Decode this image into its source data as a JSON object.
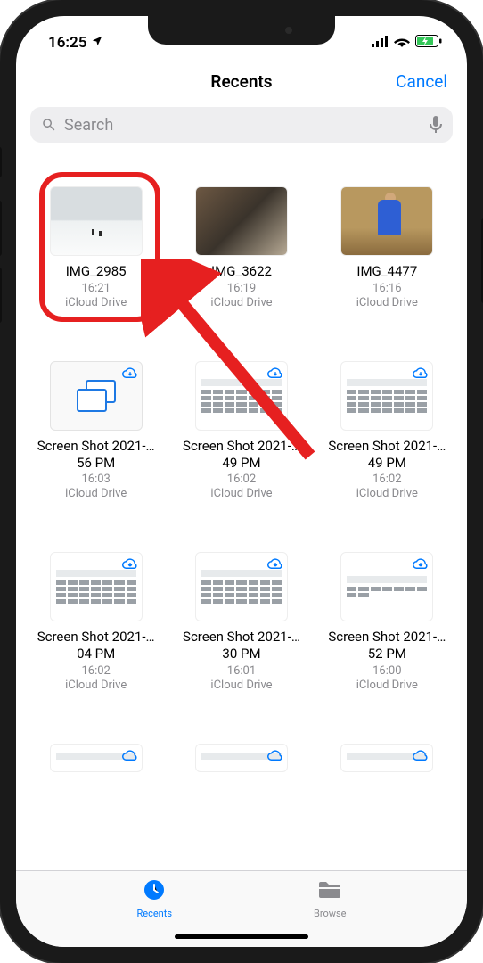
{
  "status": {
    "time": "16:25",
    "location_arrow": "➤"
  },
  "nav": {
    "title": "Recents",
    "cancel": "Cancel"
  },
  "search": {
    "placeholder": "Search"
  },
  "files": [
    {
      "name": "IMG_2985",
      "time": "16:21",
      "location": "iCloud Drive",
      "thumb": "snow",
      "cloud": false
    },
    {
      "name": "IMG_3622",
      "time": "16:19",
      "location": "iCloud Drive",
      "thumb": "dog",
      "cloud": false
    },
    {
      "name": "IMG_4477",
      "time": "16:16",
      "location": "iCloud Drive",
      "thumb": "person",
      "cloud": false
    },
    {
      "name": "Screen Shot 2021-…56 PM",
      "time": "16:03",
      "location": "iCloud Drive",
      "thumb": "doc",
      "cloud": true
    },
    {
      "name": "Screen Shot 2021-…49 PM",
      "time": "16:02",
      "location": "iCloud Drive",
      "thumb": "screenshot",
      "cloud": true
    },
    {
      "name": "Screen Shot 2021-…49 PM",
      "time": "16:02",
      "location": "iCloud Drive",
      "thumb": "screenshot",
      "cloud": true
    },
    {
      "name": "Screen Shot 2021-…04 PM",
      "time": "16:02",
      "location": "iCloud Drive",
      "thumb": "screenshot",
      "cloud": true
    },
    {
      "name": "Screen Shot 2021-…30 PM",
      "time": "16:01",
      "location": "iCloud Drive",
      "thumb": "screenshot",
      "cloud": true
    },
    {
      "name": "Screen Shot 2021-…52 PM",
      "time": "16:00",
      "location": "iCloud Drive",
      "thumb": "screenshot-sparse",
      "cloud": true
    }
  ],
  "tabs": {
    "recents": "Recents",
    "browse": "Browse"
  },
  "highlighted_index": 0
}
